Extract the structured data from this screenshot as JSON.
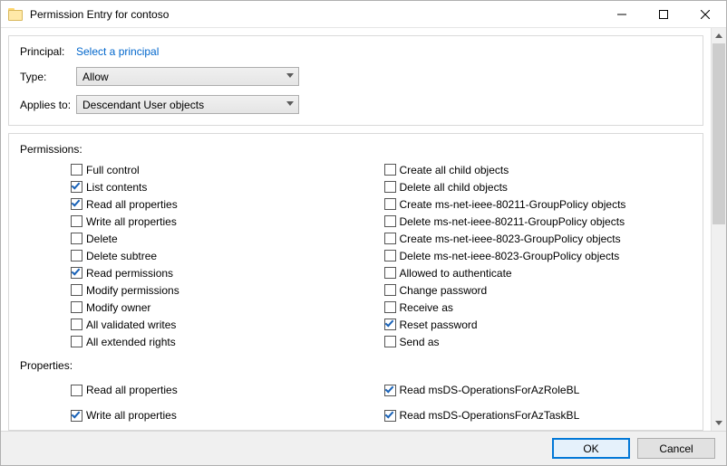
{
  "window": {
    "title": "Permission Entry for contoso"
  },
  "header": {
    "principal_label": "Principal:",
    "principal_link": "Select a principal",
    "type_label": "Type:",
    "type_value": "Allow",
    "applies_label": "Applies to:",
    "applies_value": "Descendant User objects"
  },
  "permissions": {
    "section_label": "Permissions:",
    "left": [
      {
        "label": "Full control",
        "checked": false
      },
      {
        "label": "List contents",
        "checked": true
      },
      {
        "label": "Read all properties",
        "checked": true
      },
      {
        "label": "Write all properties",
        "checked": false
      },
      {
        "label": "Delete",
        "checked": false
      },
      {
        "label": "Delete subtree",
        "checked": false
      },
      {
        "label": "Read permissions",
        "checked": true
      },
      {
        "label": "Modify permissions",
        "checked": false
      },
      {
        "label": "Modify owner",
        "checked": false
      },
      {
        "label": "All validated writes",
        "checked": false
      },
      {
        "label": "All extended rights",
        "checked": false
      }
    ],
    "right": [
      {
        "label": "Create all child objects",
        "checked": false
      },
      {
        "label": "Delete all child objects",
        "checked": false
      },
      {
        "label": "Create ms-net-ieee-80211-GroupPolicy objects",
        "checked": false
      },
      {
        "label": "Delete ms-net-ieee-80211-GroupPolicy objects",
        "checked": false
      },
      {
        "label": "Create ms-net-ieee-8023-GroupPolicy objects",
        "checked": false
      },
      {
        "label": "Delete ms-net-ieee-8023-GroupPolicy objects",
        "checked": false
      },
      {
        "label": "Allowed to authenticate",
        "checked": false
      },
      {
        "label": "Change password",
        "checked": false
      },
      {
        "label": "Receive as",
        "checked": false
      },
      {
        "label": "Reset password",
        "checked": true
      },
      {
        "label": "Send as",
        "checked": false
      }
    ]
  },
  "properties": {
    "section_label": "Properties:",
    "left": [
      {
        "label": "Read all properties",
        "checked": false
      },
      {
        "label": "Write all properties",
        "checked": true
      }
    ],
    "right": [
      {
        "label": "Read msDS-OperationsForAzRoleBL",
        "checked": true
      },
      {
        "label": "Read msDS-OperationsForAzTaskBL",
        "checked": true
      }
    ]
  },
  "footer": {
    "ok": "OK",
    "cancel": "Cancel"
  }
}
